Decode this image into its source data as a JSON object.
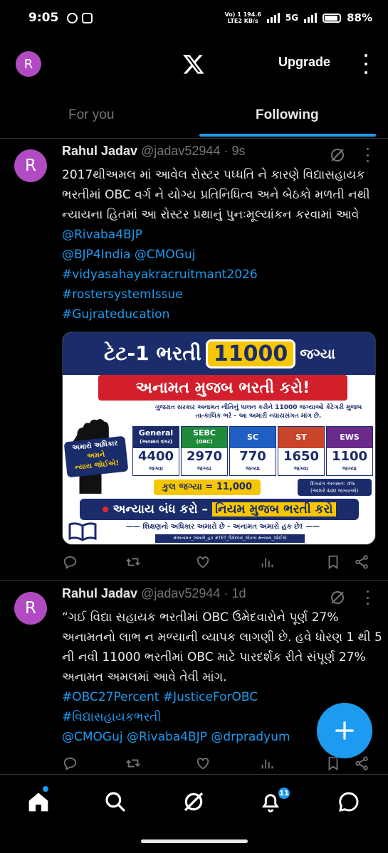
{
  "status_bar": {
    "time": "9:05",
    "net_line1": "Vo) 1 194.6",
    "net_line2": "LTE2 KB/s",
    "network_type": "5G",
    "battery_percent": "88%",
    "battery_level": 0.88
  },
  "header": {
    "avatar_letter": "R",
    "upgrade_label": "Upgrade"
  },
  "tabs": {
    "for_you": "For you",
    "following": "Following",
    "active": "Following"
  },
  "posts": [
    {
      "avatar_letter": "R",
      "name": "Rahul Jadav",
      "handle": "@jadav52944",
      "dot": "·",
      "time": "9s",
      "text": "2017થીઅમલ માં આવેલ રોસ્ટર પધ્ધતિ ને કારણે વિદ્યાસહાયક ભરતીમાં OBC વર્ગ ને યોગ્ય પ્રતિનિધિત્વ અને બેઠકો મળતી નથી ન્યાયના હિતમાં આ રોસ્ટર પ્રથાનું પુનઃમૂલ્યાંકન કરવામાં આવે",
      "mention_inline": "@Rivaba4BJP",
      "links": [
        "@BJP4India @CMOGuj",
        "#vidyasahayakracruitmant2026",
        "#rostersystemIssue",
        "#Gujrateducation"
      ],
      "image": {
        "title": "ટેટ-1 ભરતી",
        "count": "11000",
        "suffix": "જગ્યા",
        "banner": "અનામત મુજબ ભરતી કરો!",
        "subtitle": "ગુજરાત સરકાર અનામત નીતિનું પાલન કરીને 11000 જગ્યાઓ કેટેગરી મુજબ તાત્કાલિક ભરે - આ અમારી ન્યાયસંગત માંગ છે.",
        "tag_line1": "અમારો અધિકાર",
        "tag_line2": "અમને",
        "tag_line3": "ન્યાય જોઈએ!",
        "columns": [
          {
            "head": "General",
            "sub": "(અનામત વગર)",
            "value": "4400",
            "unit": "જગ્યા",
            "color": "#1b2c6b"
          },
          {
            "head": "SEBC",
            "sub": "(OBC)",
            "value": "2970",
            "unit": "જગ્યા",
            "color": "#1f8a3c"
          },
          {
            "head": "SC",
            "sub": "",
            "value": "770",
            "unit": "જગ્યા",
            "color": "#1f5fc4"
          },
          {
            "head": "ST",
            "sub": "",
            "value": "1650",
            "unit": "જગ્યા",
            "color": "#c8442a"
          },
          {
            "head": "EWS",
            "sub": "",
            "value": "1100",
            "unit": "જગ્યા",
            "color": "#6a2a8c"
          }
        ],
        "total": "કુલ જગ્યા = 11,000",
        "divyang_line1": "દિવ્યાંગ અનામત: 4%",
        "divyang_line2": "(આશરે 440 જગ્યાઓ)",
        "demand_left": "અન્યાય બંધ કરો –",
        "demand_right": "નિયમ મુજબ ભરતી કરો",
        "rights": "—— શિક્ષણનો અધિકાર અમારો છે - અનામત અમારો હક છે! ——",
        "tags": "#અનામત_અમારો_હક  #TET_ઉમેદવાર_એકતા  #ન્યાય_જોઈએ"
      }
    },
    {
      "avatar_letter": "R",
      "name": "Rahul Jadav",
      "handle": "@jadav52944",
      "dot": "·",
      "time": "1d",
      "text": "“ગઈ વિદ્યા સહાયક ભરતીમાં OBC ઉમેદવારોને પૂર્ણ 27% અનામતનો લાભ ન મળ્યાની વ્યાપક લાગણી છે. હવે ધોરણ 1 થી 5 ની નવી 11000 ભરતીમાં OBC માટે પારદર્શક રીતે સંપૂર્ણ 27% અનામત અમલમાં આવે તેવી માંગ.",
      "links": [
        "#OBC27Percent #JusticeForOBC",
        "#વિદ્યાસહાયકભરતી",
        "@CMOGuj @Rivaba4BJP @drpradyum"
      ]
    }
  ],
  "bottom_nav": {
    "notification_count": "11"
  },
  "colors": {
    "accent": "#1d9bf0",
    "avatar": "#b04bc2",
    "background": "#000000"
  }
}
